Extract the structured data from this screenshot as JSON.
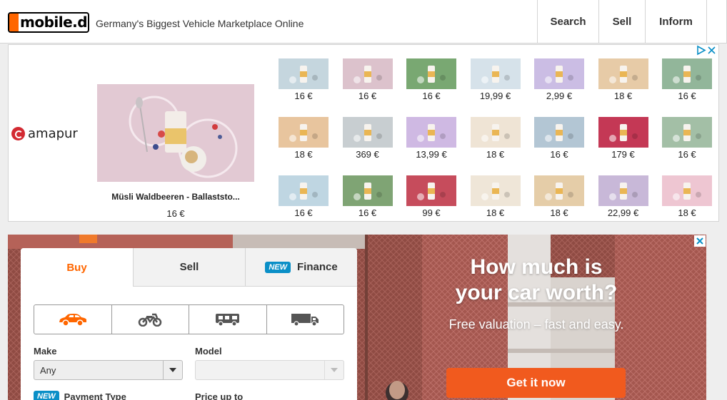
{
  "header": {
    "logo_text": "mobile.de",
    "tagline": "Germany's Biggest Vehicle Marketplace Online",
    "nav": [
      "Search",
      "Sell",
      "Inform"
    ]
  },
  "ad1": {
    "brand": "amapur",
    "feature_caption": "Müsli Waldbeeren - Ballaststo...",
    "feature_price": "16 €",
    "products": [
      {
        "price": "16 €",
        "color": "#c5d6de"
      },
      {
        "price": "16 €",
        "color": "#dcc2cc"
      },
      {
        "price": "16 €",
        "color": "#79a872"
      },
      {
        "price": "19,99 €",
        "color": "#d6e2ea"
      },
      {
        "price": "2,99 €",
        "color": "#cbbde4"
      },
      {
        "price": "18 €",
        "color": "#e7cba7"
      },
      {
        "price": "16 €",
        "color": "#92b69a"
      },
      {
        "price": "18 €",
        "color": "#e8c59e"
      },
      {
        "price": "369 €",
        "color": "#c8ced1"
      },
      {
        "price": "13,99 €",
        "color": "#cfb9e3"
      },
      {
        "price": "18 €",
        "color": "#efe4d5"
      },
      {
        "price": "16 €",
        "color": "#b3c6d4"
      },
      {
        "price": "179 €",
        "color": "#c43855"
      },
      {
        "price": "16 €",
        "color": "#a3bfa6"
      },
      {
        "price": "16 €",
        "color": "#bfd6e2"
      },
      {
        "price": "16 €",
        "color": "#7fa474"
      },
      {
        "price": "99 €",
        "color": "#c64c5c"
      },
      {
        "price": "18 €",
        "color": "#efe6d8"
      },
      {
        "price": "18 €",
        "color": "#e5cda8"
      },
      {
        "price": "22,99 €",
        "color": "#c8b8d8"
      },
      {
        "price": "18 €",
        "color": "#eec6d2"
      }
    ]
  },
  "ad2": {
    "headline_1": "How much is",
    "headline_2": "your car worth?",
    "subline": "Free valuation – fast and easy.",
    "cta": "Get it now"
  },
  "search": {
    "tabs": {
      "buy": "Buy",
      "sell": "Sell",
      "finance": "Finance",
      "new_badge": "NEW"
    },
    "vehicle_types": [
      "car-icon",
      "motorbike-icon",
      "motorhome-icon",
      "truck-icon"
    ],
    "make_label": "Make",
    "make_value": "Any",
    "model_label": "Model",
    "model_value": "",
    "payment_label": "Payment Type",
    "price_label": "Price up to",
    "accent": "#ff6600"
  }
}
